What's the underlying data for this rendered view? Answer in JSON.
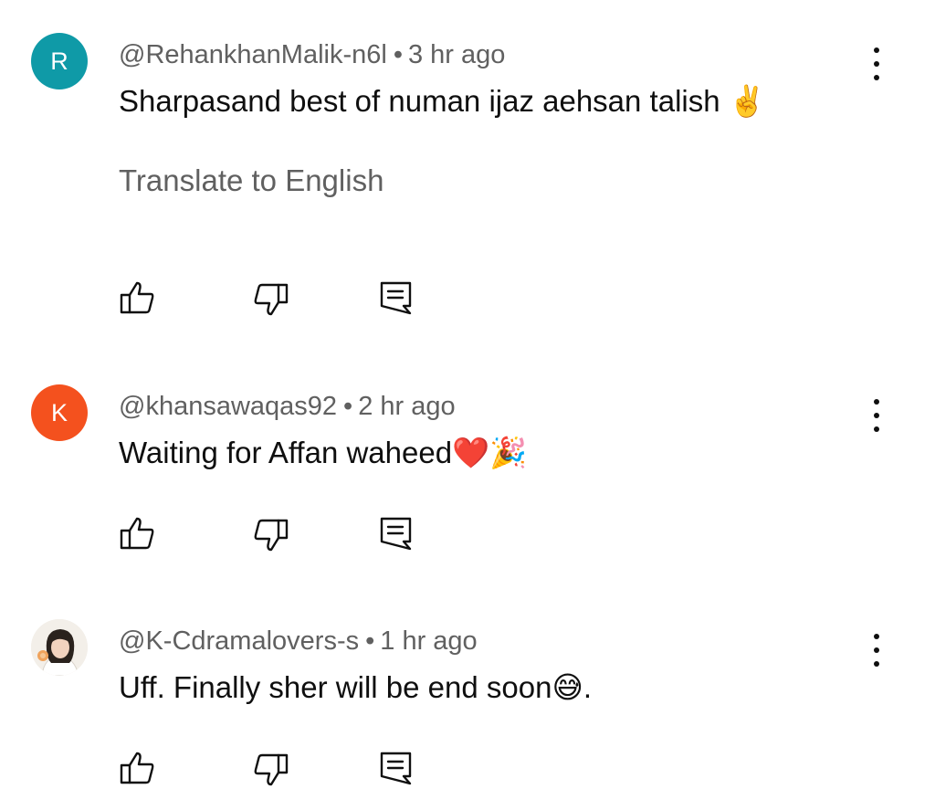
{
  "comments": [
    {
      "avatar_letter": "R",
      "avatar_color": "#0f9aa7",
      "author": "@RehankhanMalik-n6l",
      "separator": "•",
      "time": "3 hr ago",
      "text": "Sharpasand best of numan ijaz aehsan talish",
      "emoji": "✌️",
      "translate": "Translate to English"
    },
    {
      "avatar_letter": "K",
      "avatar_color": "#f4511e",
      "author": "@khansawaqas92",
      "separator": "•",
      "time": "2 hr ago",
      "text": "Waiting for Affan waheed",
      "emoji": "❤️🎉"
    },
    {
      "avatar_image": "profile-photo",
      "author": "@K-Cdramalovers-s",
      "separator": "•",
      "time": "1 hr ago",
      "text": "Uff. Finally sher will be end soon",
      "emoji": "😅",
      "text_suffix": "."
    }
  ],
  "icons": {
    "like": "thumbs-up-icon",
    "dislike": "thumbs-down-icon",
    "reply": "reply-comment-icon",
    "menu": "more-vert-icon"
  },
  "colors": {
    "primary_text": "#0f0f0f",
    "secondary_text": "#606060",
    "background": "#ffffff"
  }
}
